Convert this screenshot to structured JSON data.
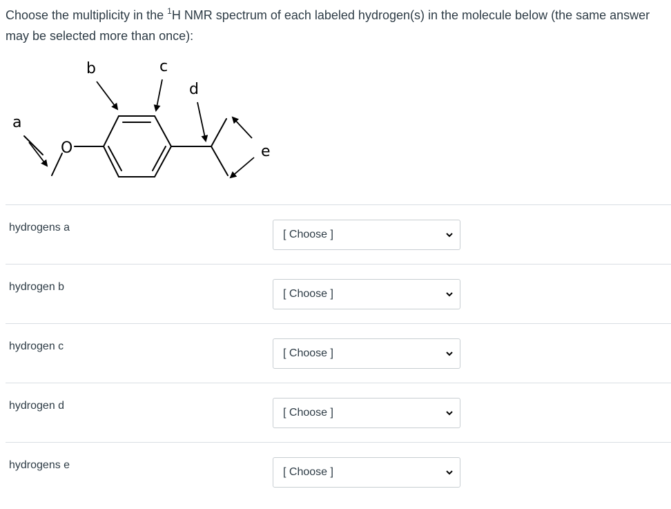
{
  "question": {
    "text_before": "Choose the multiplicity in the ",
    "superscript": "1",
    "text_after": "H NMR spectrum of each labeled hydrogen(s) in the molecule below (the same answer may be selected more than once):"
  },
  "molecule": {
    "labels": {
      "a": "a",
      "b": "b",
      "c": "c",
      "d": "d",
      "e": "e",
      "oxygen": "O"
    }
  },
  "rows": [
    {
      "label": "hydrogens a",
      "selected": "[ Choose ]"
    },
    {
      "label": "hydrogen b",
      "selected": "[ Choose ]"
    },
    {
      "label": "hydrogen c",
      "selected": "[ Choose ]"
    },
    {
      "label": "hydrogen d",
      "selected": "[ Choose ]"
    },
    {
      "label": "hydrogens e",
      "selected": "[ Choose ]"
    }
  ],
  "icons": {
    "dropdown": "chevron-down-icon"
  }
}
